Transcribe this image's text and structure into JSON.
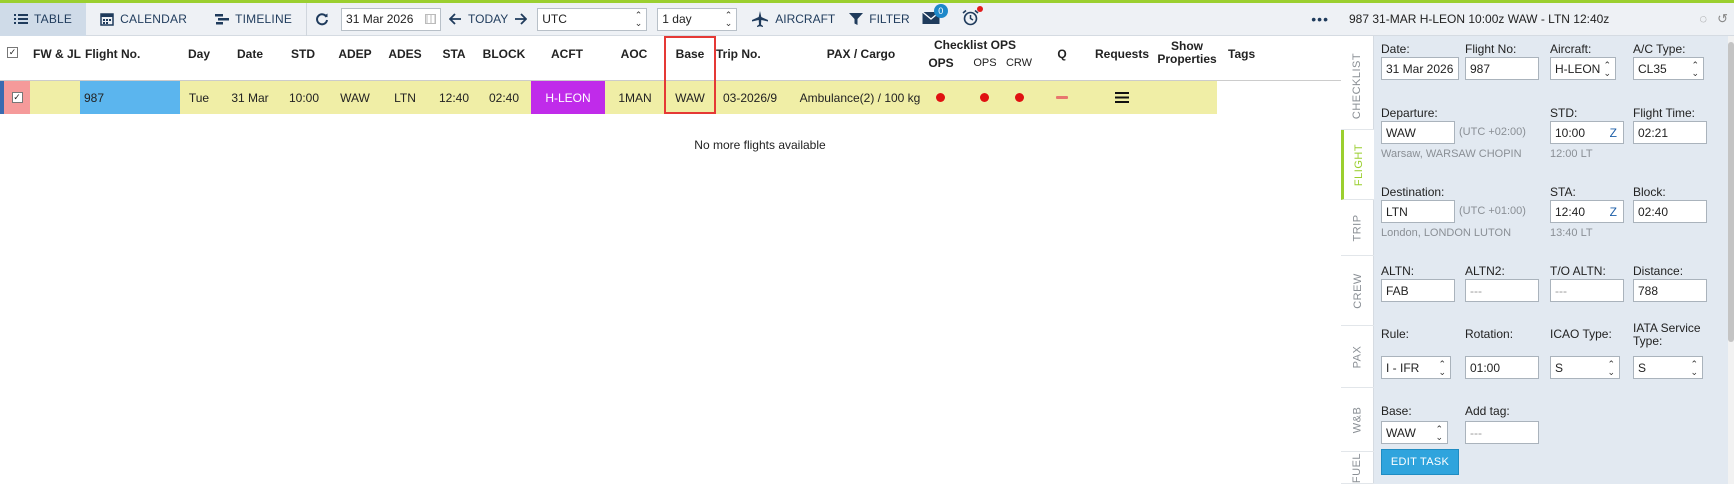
{
  "toolbar": {
    "tabs": [
      {
        "label": "TABLE",
        "icon": "list-icon"
      },
      {
        "label": "CALENDAR",
        "icon": "calendar-icon"
      },
      {
        "label": "TIMELINE",
        "icon": "timeline-icon"
      }
    ],
    "date": "31 Mar 2026",
    "today": "TODAY",
    "timezone": "UTC",
    "range": "1 day",
    "aircraft": "AIRCRAFT",
    "filter": "FILTER",
    "messages_count": "0"
  },
  "table": {
    "headers": {
      "fwjl": "FW & JL",
      "flight_no": "Flight No.",
      "day": "Day",
      "date": "Date",
      "std": "STD",
      "adep": "ADEP",
      "ades": "ADES",
      "sta": "STA",
      "block": "BLOCK",
      "acft": "ACFT",
      "aoc": "AOC",
      "base": "Base",
      "trip_no": "Trip No.",
      "pax_cargo": "PAX / Cargo",
      "checklist_ops": "Checklist OPS",
      "ops": "OPS",
      "ops_small": "OPS",
      "crw": "CRW",
      "q": "Q",
      "requests": "Requests",
      "show_properties": "Show Properties",
      "tags": "Tags"
    },
    "row": {
      "flight_no": "987",
      "day": "Tue",
      "date": "31 Mar",
      "std": "10:00",
      "adep": "WAW",
      "ades": "LTN",
      "sta": "12:40",
      "block": "02:40",
      "acft": "H-LEON",
      "aoc": "1MAN",
      "base": "WAW",
      "trip_no": "03-2026/9",
      "pax_cargo": "Ambulance(2) / 100 kg"
    },
    "no_more": "No more flights available",
    "colors": {
      "acft_bg": "#c02bea",
      "flight_bg": "#5bb5ee",
      "row_bg": "#f0eea6",
      "fwjl_red": "#f59a9a"
    }
  },
  "panel": {
    "header": "987  31-MAR  H-LEON 10:00z WAW - LTN 12:40z",
    "tabs": [
      "CHECKLIST",
      "FLIGHT",
      "TRIP",
      "CREW",
      "PAX",
      "W&B",
      "FUEL"
    ],
    "fields": {
      "date_label": "Date:",
      "date_value": "31 Mar 2026",
      "flight_no_label": "Flight No:",
      "flight_no_value": "987",
      "aircraft_label": "Aircraft:",
      "aircraft_value": "H-LEON",
      "ac_type_label": "A/C Type:",
      "ac_type_value": "CL35",
      "departure_label": "Departure:",
      "departure_value": "WAW",
      "departure_tz": "(UTC +02:00)",
      "departure_name": "Warsaw, WARSAW CHOPIN",
      "std_label": "STD:",
      "std_value": "10:00",
      "std_z": "Z",
      "std_lt": "12:00 LT",
      "flight_time_label": "Flight Time:",
      "flight_time_value": "02:21",
      "destination_label": "Destination:",
      "destination_value": "LTN",
      "destination_tz": "(UTC +01:00)",
      "destination_name": "London, LONDON LUTON",
      "sta_label": "STA:",
      "sta_value": "12:40",
      "sta_z": "Z",
      "sta_lt": "13:40 LT",
      "block_label": "Block:",
      "block_value": "02:40",
      "altn_label": "ALTN:",
      "altn_value": "FAB",
      "altn2_label": "ALTN2:",
      "altn2_value": "---",
      "to_altn_label": "T/O ALTN:",
      "to_altn_value": "---",
      "distance_label": "Distance:",
      "distance_value": "788",
      "rule_label": "Rule:",
      "rule_value": "I - IFR",
      "rotation_label": "Rotation:",
      "rotation_value": "01:00",
      "icao_type_label": "ICAO Type:",
      "icao_type_value": "S",
      "iata_service_label": "IATA Service Type:",
      "iata_service_value": "S",
      "base_label": "Base:",
      "base_value": "WAW",
      "add_tag_label": "Add tag:",
      "add_tag_value": "---"
    },
    "edit_task": "EDIT TASK"
  }
}
